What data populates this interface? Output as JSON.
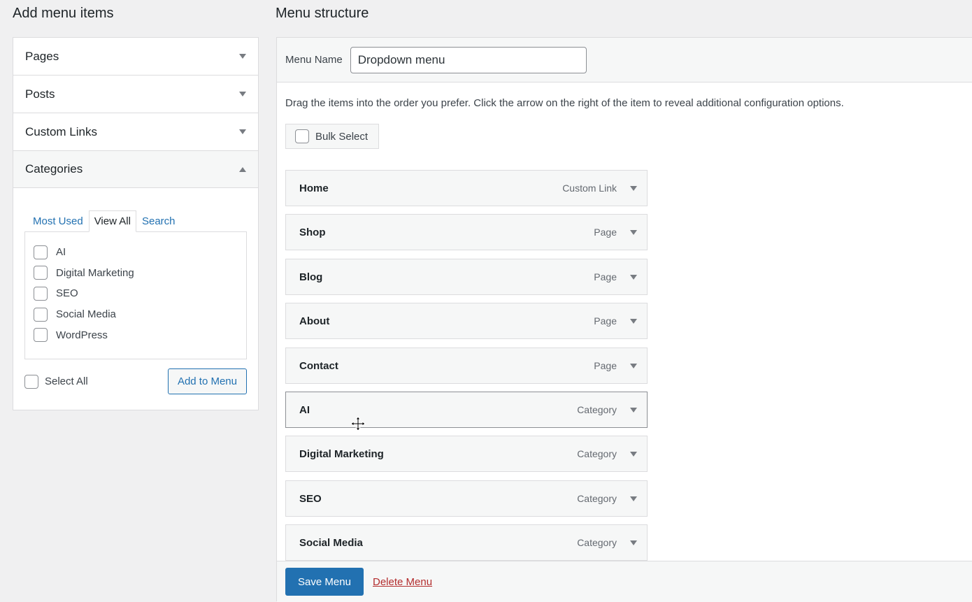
{
  "left": {
    "title": "Add menu items",
    "sections": [
      {
        "label": "Pages"
      },
      {
        "label": "Posts"
      },
      {
        "label": "Custom Links"
      },
      {
        "label": "Categories"
      }
    ],
    "categories": {
      "tabs": [
        "Most Used",
        "View All",
        "Search"
      ],
      "active_tab": "View All",
      "items": [
        "AI",
        "Digital Marketing",
        "SEO",
        "Social Media",
        "WordPress"
      ],
      "select_all_label": "Select All",
      "add_button_label": "Add to Menu"
    }
  },
  "right": {
    "title": "Menu structure",
    "menu_name_label": "Menu Name",
    "menu_name_value": "Dropdown menu",
    "instructions": "Drag the items into the order you prefer. Click the arrow on the right of the item to reveal additional configuration options.",
    "bulk_select_label": "Bulk Select",
    "items": [
      {
        "title": "Home",
        "type": "Custom Link"
      },
      {
        "title": "Shop",
        "type": "Page"
      },
      {
        "title": "Blog",
        "type": "Page"
      },
      {
        "title": "About",
        "type": "Page"
      },
      {
        "title": "Contact",
        "type": "Page"
      },
      {
        "title": "AI",
        "type": "Category"
      },
      {
        "title": "Digital Marketing",
        "type": "Category"
      },
      {
        "title": "SEO",
        "type": "Category"
      },
      {
        "title": "Social Media",
        "type": "Category"
      }
    ],
    "save_label": "Save Menu",
    "delete_label": "Delete Menu"
  },
  "colors": {
    "primary": "#2271b1",
    "danger": "#b32d2e",
    "background": "#f0f0f1"
  }
}
